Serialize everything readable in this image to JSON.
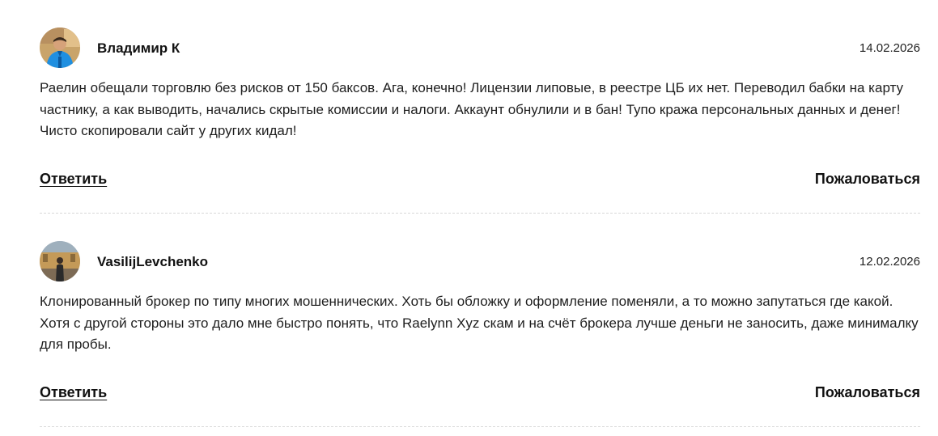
{
  "comments": [
    {
      "author": "Владимир К",
      "date": "14.02.2026",
      "text": "Раелин обещали торговлю без рисков от 150 баксов. Ага, конечно! Лицензии липовые, в реестре ЦБ их нет. Переводил бабки на карту частнику, а как выводить, начались скрытые комиссии и налоги. Аккаунт обнулили и в бан! Тупо кража персональных данных и денег! Чисто скопировали сайт у других кидал!",
      "reply_label": "Ответить",
      "complain_label": "Пожаловаться"
    },
    {
      "author": "VasilijLevchenko",
      "date": "12.02.2026",
      "text": "Клонированный брокер по типу многих мошеннических. Хоть бы обложку и оформление поменяли, а то можно запутаться где какой. Хотя с другой стороны это дало мне быстро понять, что Raelynn Xyz скам и на счёт брокера лучше деньги не заносить, даже минималку для пробы.",
      "reply_label": "Ответить",
      "complain_label": "Пожаловаться"
    }
  ],
  "colors": {
    "text": "#1a1a1a",
    "divider": "#d8d8d8"
  }
}
